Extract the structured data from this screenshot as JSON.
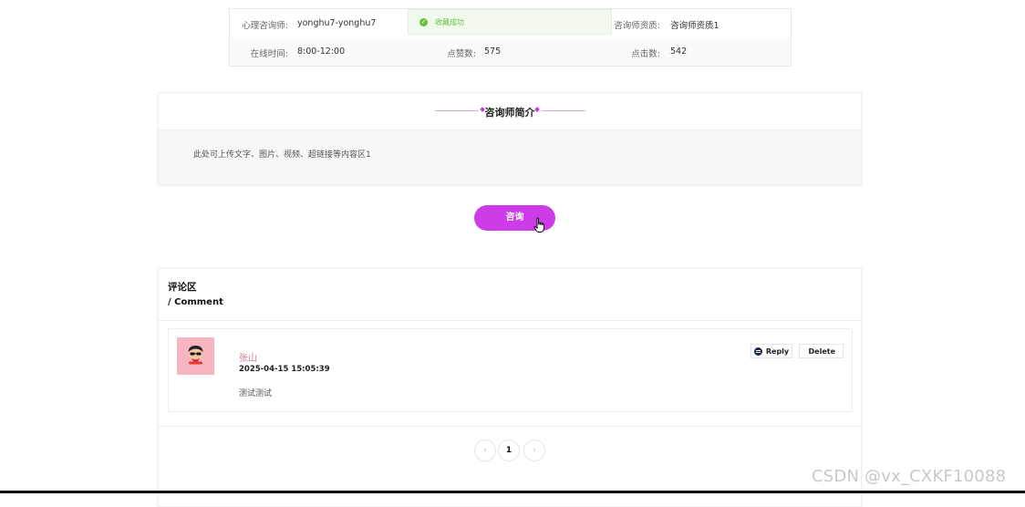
{
  "info": {
    "row1": {
      "label1": "心理咨询师:",
      "value1": "yonghu7-yonghu7",
      "toast": "收藏成功",
      "label3": "咨询师资质:",
      "value3": "咨询师资质1"
    },
    "row2": {
      "label1": "在线时间:",
      "value1": "8:00-12:00",
      "label2": "点赞数:",
      "value2": "575",
      "label3": "点击数:",
      "value3": "542"
    }
  },
  "intro": {
    "title": "咨询师简介",
    "content": "此处可上传文字、图片、视频、超链接等内容区1"
  },
  "consult_button": "咨询",
  "comments": {
    "title": "评论区",
    "subtitle": "/ Comment",
    "items": [
      {
        "user": "张山",
        "time": "2025-04-15 15:05:39",
        "content": "测试测试",
        "reply_label": "Reply",
        "delete_label": "Delete"
      }
    ],
    "pagination": {
      "prev": "‹",
      "current": "1",
      "next": "›"
    }
  },
  "watermark": "CSDN @vx_CXKF10088",
  "colors": {
    "accent": "#cd3be6",
    "success": "#67c23a",
    "avatar_bg": "#f6b5c1",
    "username": "#e07a8a"
  }
}
